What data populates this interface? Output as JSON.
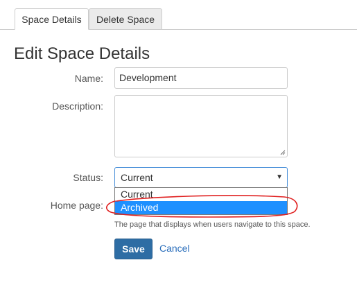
{
  "tabs": [
    {
      "label": "Space Details",
      "active": true
    },
    {
      "label": "Delete Space",
      "active": false
    }
  ],
  "page_title": "Edit Space Details",
  "form": {
    "name": {
      "label": "Name:",
      "value": "Development"
    },
    "description": {
      "label": "Description:",
      "value": ""
    },
    "status": {
      "label": "Status:",
      "selected": "Current",
      "options": [
        "Current",
        "Archived"
      ],
      "highlighted_option": "Archived"
    },
    "home_page": {
      "label": "Home page:",
      "help": "The page that displays when users navigate to this space."
    }
  },
  "actions": {
    "save_label": "Save",
    "cancel_label": "Cancel"
  },
  "colors": {
    "primary_button": "#2e6da4",
    "link": "#2a6ebb",
    "option_highlight": "#1e90ff",
    "annotation": "#e02020"
  },
  "icons": {
    "select_arrow": "caret-down-icon",
    "resize": "resize-grip-icon"
  }
}
